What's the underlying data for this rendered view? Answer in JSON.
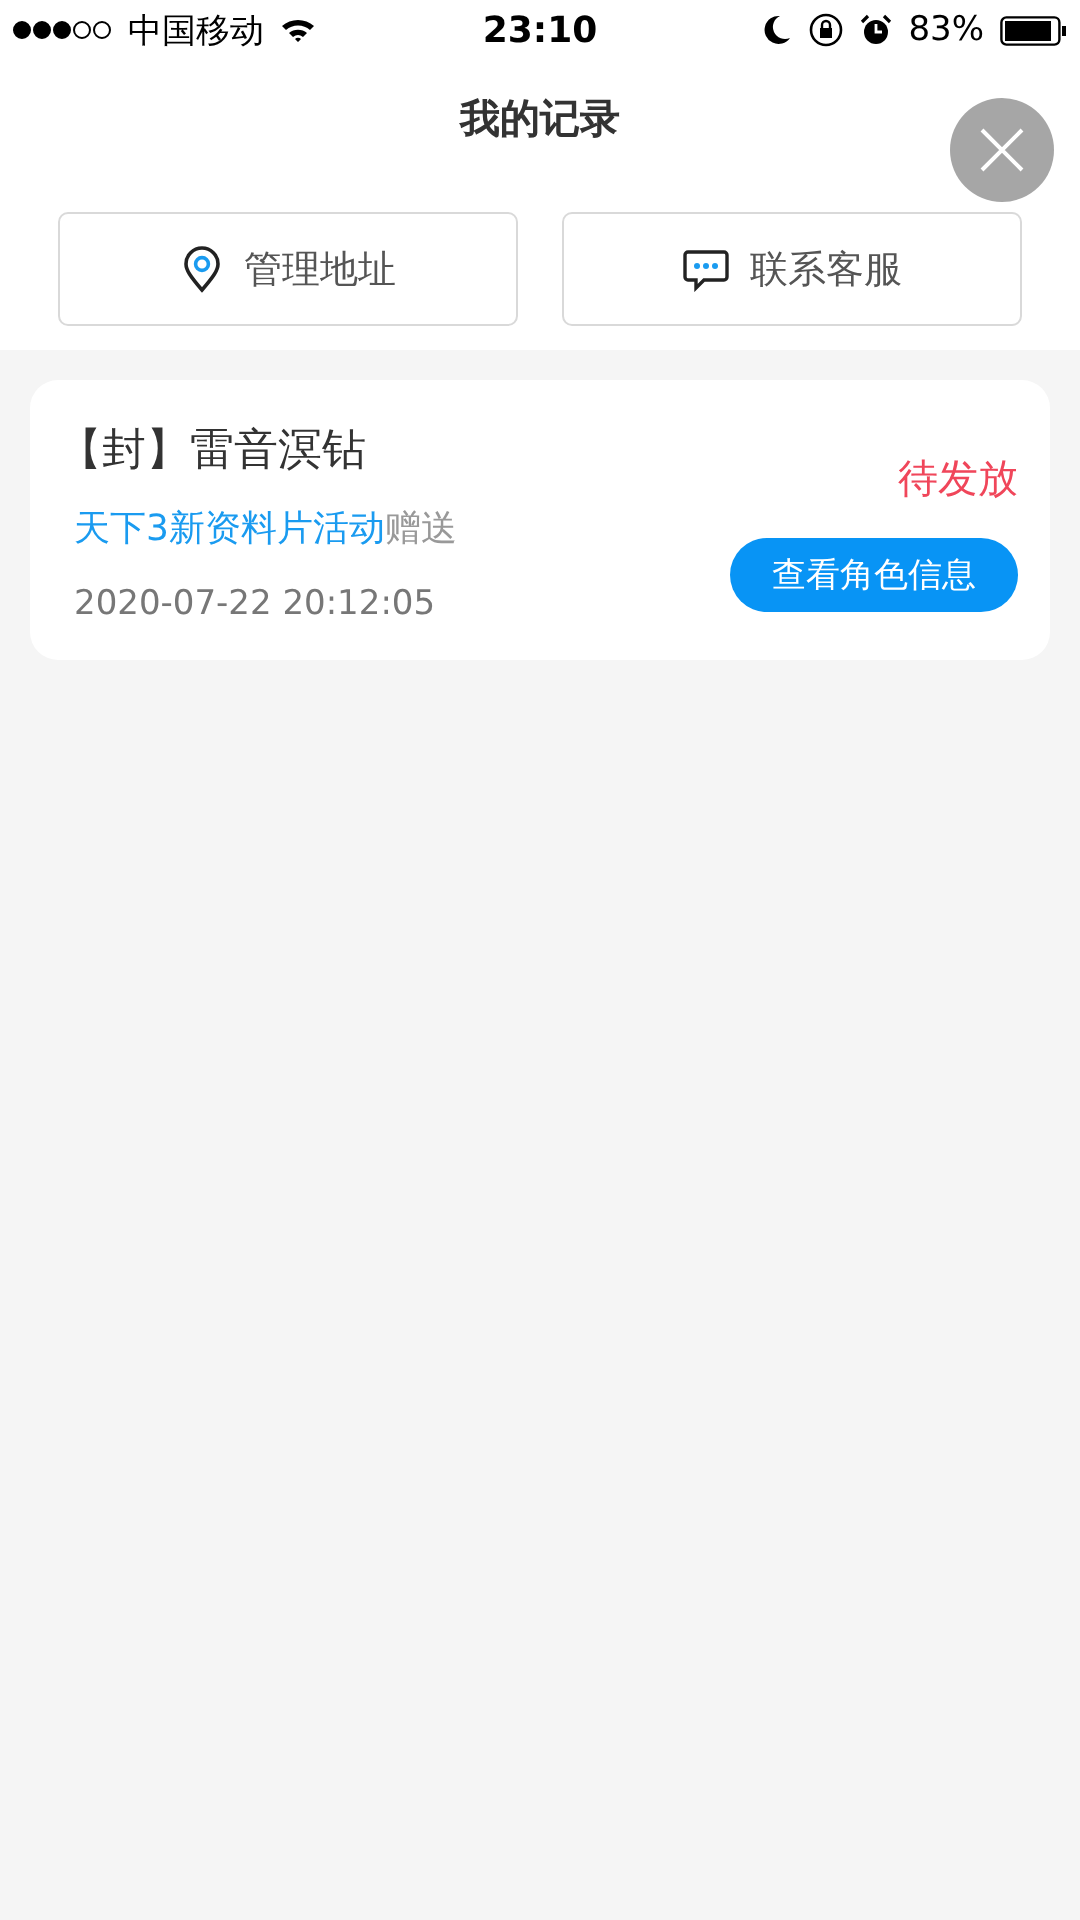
{
  "status_bar": {
    "carrier": "中国移动",
    "time": "23:10",
    "battery": "83%"
  },
  "header": {
    "title": "我的记录"
  },
  "actions": [
    {
      "kind": "location",
      "label": "管理地址"
    },
    {
      "kind": "chat",
      "label": "联系客服"
    }
  ],
  "records": [
    {
      "title": "【封】雷音溟钻",
      "source": "天下3新资料片活动",
      "source_suffix": "赠送",
      "time": "2020-07-22 20:12:05",
      "status": "待发放",
      "button": "查看角色信息"
    }
  ]
}
